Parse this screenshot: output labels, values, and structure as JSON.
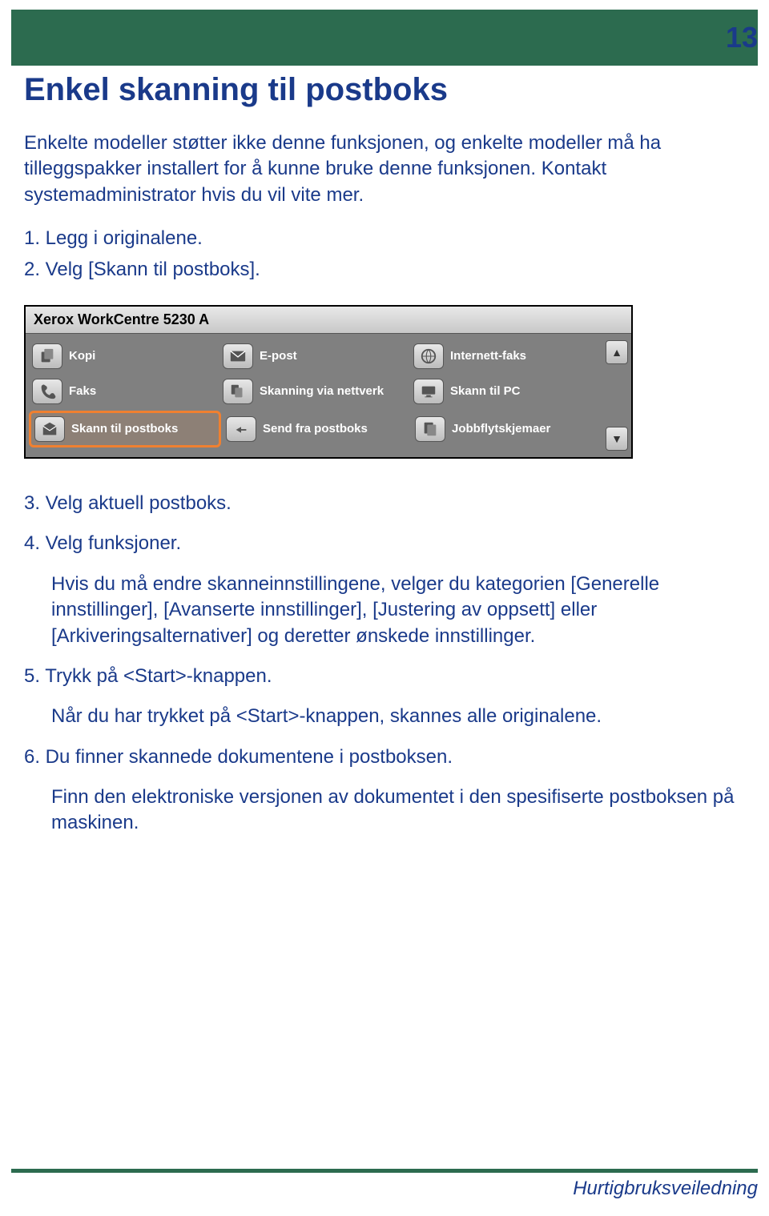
{
  "page_number": "13",
  "title": "Enkel skanning til postboks",
  "intro": "Enkelte modeller støtter ikke denne funksjonen, og enkelte modeller må ha tilleggspakker installert for å kunne bruke denne funksjonen. Kontakt systemadministrator hvis du vil vite mer.",
  "steps": {
    "s1": "1. Legg i originalene.",
    "s2": "2. Velg [Skann til postboks].",
    "s3": "3. Velg aktuell postboks.",
    "s4": "4. Velg funksjoner.",
    "note4": "Hvis du må endre skanneinnstillingene, velger du kategorien [Generelle innstillinger], [Avanserte innstillinger], [Justering av oppsett] eller [Arkiveringsalternativer] og deretter ønskede innstillinger.",
    "s5": "5. Trykk på <Start>-knappen.",
    "note5": "Når du har trykket på <Start>-knappen, skannes alle originalene.",
    "s6": "6. Du finner skannede dokumentene i postboksen.",
    "note6": "Finn den elektroniske versjonen av dokumentet i den spesifiserte postboksen på maskinen."
  },
  "screenshot": {
    "header": "Xerox WorkCentre 5230 A",
    "items": {
      "r1c1": "Kopi",
      "r1c2": "E-post",
      "r1c3": "Internett-faks",
      "r2c1": "Faks",
      "r2c2": "Skanning via nettverk",
      "r2c3": "Skann til PC",
      "r3c1": "Skann til postboks",
      "r3c2": "Send fra postboks",
      "r3c3": "Jobbflytskjemaer"
    }
  },
  "footer": "Hurtigbruksveiledning"
}
